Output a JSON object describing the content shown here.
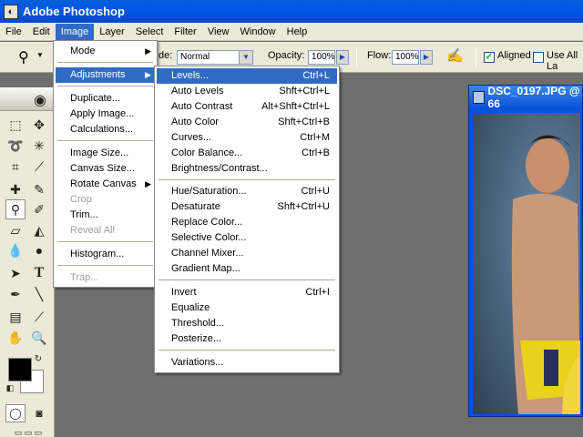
{
  "app": {
    "title": "Adobe Photoshop"
  },
  "menubar": [
    "File",
    "Edit",
    "Image",
    "Layer",
    "Select",
    "Filter",
    "View",
    "Window",
    "Help"
  ],
  "options": {
    "mode_label": "de:",
    "mode_value": "Normal",
    "opacity_label": "Opacity:",
    "opacity_value": "100%",
    "flow_label": "Flow:",
    "flow_value": "100%",
    "aligned_label": "Aligned",
    "use_all_label": "Use All La"
  },
  "document": {
    "title": "DSC_0197.JPG @ 66"
  },
  "image_menu": [
    {
      "label": "Mode",
      "submenu": true
    },
    {
      "label": "Adjustments",
      "submenu": true,
      "highlighted": true
    },
    {
      "label": "Duplicate..."
    },
    {
      "label": "Apply Image..."
    },
    {
      "label": "Calculations..."
    },
    {
      "label": "Image Size..."
    },
    {
      "label": "Canvas Size..."
    },
    {
      "label": "Rotate Canvas",
      "submenu": true
    },
    {
      "label": "Crop",
      "disabled": true
    },
    {
      "label": "Trim..."
    },
    {
      "label": "Reveal All",
      "disabled": true
    },
    {
      "label": "Histogram..."
    },
    {
      "label": "Trap...",
      "disabled": true
    }
  ],
  "adjustments_menu": [
    {
      "label": "Levels...",
      "shortcut": "Ctrl+L",
      "highlighted": true
    },
    {
      "label": "Auto Levels",
      "shortcut": "Shft+Ctrl+L"
    },
    {
      "label": "Auto Contrast",
      "shortcut": "Alt+Shft+Ctrl+L"
    },
    {
      "label": "Auto Color",
      "shortcut": "Shft+Ctrl+B"
    },
    {
      "label": "Curves...",
      "shortcut": "Ctrl+M"
    },
    {
      "label": "Color Balance...",
      "shortcut": "Ctrl+B"
    },
    {
      "label": "Brightness/Contrast...",
      "shortcut": ""
    },
    {
      "label": "Hue/Saturation...",
      "shortcut": "Ctrl+U"
    },
    {
      "label": "Desaturate",
      "shortcut": "Shft+Ctrl+U"
    },
    {
      "label": "Replace Color...",
      "shortcut": ""
    },
    {
      "label": "Selective Color...",
      "shortcut": ""
    },
    {
      "label": "Channel Mixer...",
      "shortcut": ""
    },
    {
      "label": "Gradient Map...",
      "shortcut": ""
    },
    {
      "label": "Invert",
      "shortcut": "Ctrl+I"
    },
    {
      "label": "Equalize",
      "shortcut": ""
    },
    {
      "label": "Threshold...",
      "shortcut": ""
    },
    {
      "label": "Posterize...",
      "shortcut": ""
    },
    {
      "label": "Variations...",
      "shortcut": ""
    }
  ],
  "colors": {
    "accent": "#316ac5",
    "titlebar": "#0058e6",
    "workspace": "#6e6e6e"
  }
}
